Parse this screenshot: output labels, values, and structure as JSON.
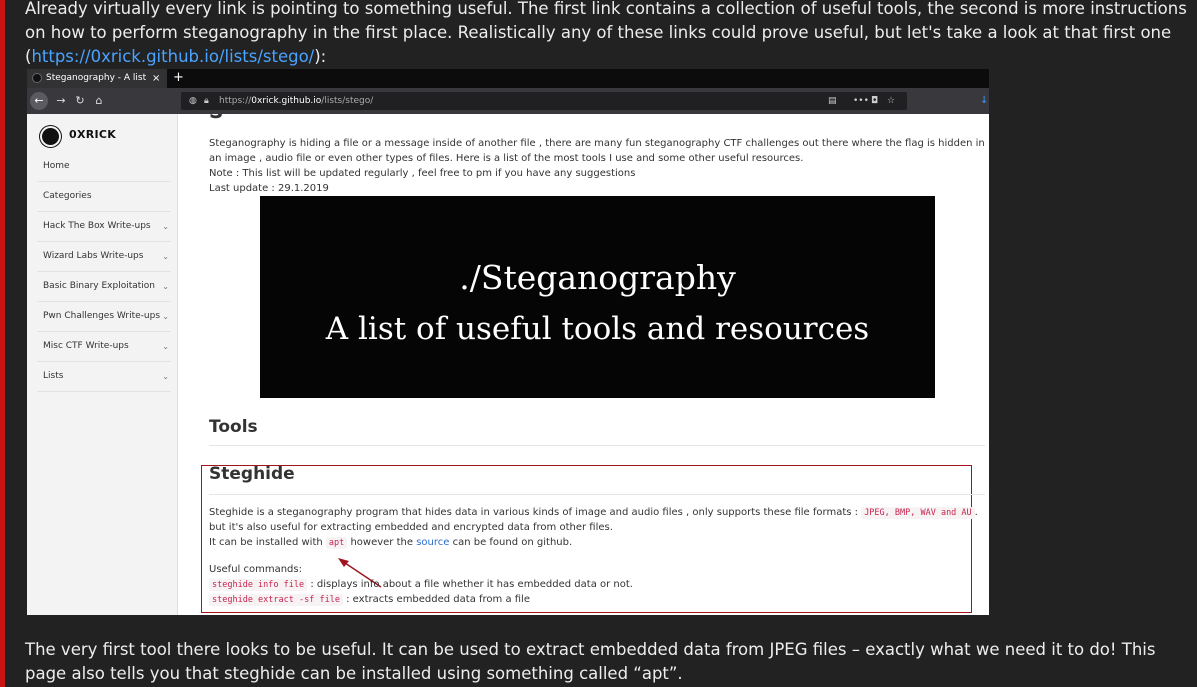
{
  "article": {
    "intro_pre": "Already virtually every link is pointing to something useful. The first link contains a collection of useful tools, the second is more instructions on how to perform steganography in the first place. Realistically any of these links could prove useful, but let's take a look at that first one (",
    "intro_link": "https://0xrick.github.io/lists/stego/",
    "intro_post": "):",
    "outro": "The very first tool there looks to be useful. It can be used to extract embedded data from JPEG files – exactly what we need it to do! This page also tells you that steghide can be installed using something called “apt”.",
    "accent_color": "#c81414",
    "link_color": "#4aa3ff"
  },
  "browser": {
    "tab_title": "Steganography - A list of",
    "tab_close": "×",
    "new_tab": "+",
    "back": "←",
    "forward": "→",
    "reload": "↻",
    "home": "⌂",
    "url_prefix": "https://",
    "url_host": "0xrick.github.io",
    "url_path": "/lists/stego/",
    "reader_icon": "▤",
    "more_icon": "•••",
    "pocket_icon": "◘",
    "bookmark_icon": "☆",
    "download_icon": "↓"
  },
  "sidebar": {
    "brand": "0XRICK",
    "items": [
      {
        "label": "Home",
        "chevron": ""
      },
      {
        "label": "Categories",
        "chevron": ""
      },
      {
        "label": "Hack The Box Write-ups",
        "chevron": "⌄"
      },
      {
        "label": "Wizard Labs Write-ups",
        "chevron": "⌄"
      },
      {
        "label": "Basic Binary Exploitation",
        "chevron": "⌄"
      },
      {
        "label": "Pwn Challenges Write-ups",
        "chevron": "⌄"
      },
      {
        "label": "Misc CTF Write-ups",
        "chevron": "⌄"
      },
      {
        "label": "Lists",
        "chevron": "⌄"
      }
    ]
  },
  "page": {
    "intro_lines": [
      "Steganography is hiding a file or a message inside of another file , there are many fun steganography CTF challenges out there where the flag is hidden in",
      "an image , audio file or even other types of files. Here is a list of the most tools I use and some other useful resources.",
      "Note : This list will be updated regularly , feel free to pm if you have any suggestions",
      "Last update : 29.1.2019"
    ],
    "banner_line1": "./Steganography",
    "banner_line2": "A list of useful tools and resources",
    "tools_heading": "Tools",
    "steghide": {
      "heading": "Steghide",
      "desc_pre": "Steghide is a steganography program that hides data in various kinds of image and audio files , only supports these file formats :",
      "formats": "JPEG, BMP, WAV and AU",
      "desc_end": ".",
      "desc_line2": "but it's also useful for extracting embedded and encrypted data from other files.",
      "install_pre": "It can be installed with",
      "install_cmd": "apt",
      "install_mid": "however the",
      "install_link": "source",
      "install_post": "can be found on github.",
      "useful_label": "Useful commands:",
      "cmd1": "steghide info file",
      "cmd1_desc": ": displays info about a file whether it has embedded data or not.",
      "cmd2": "steghide extract -sf file",
      "cmd2_desc": ": extracts embedded data from a file"
    },
    "highlight_color": "#a0141e"
  }
}
